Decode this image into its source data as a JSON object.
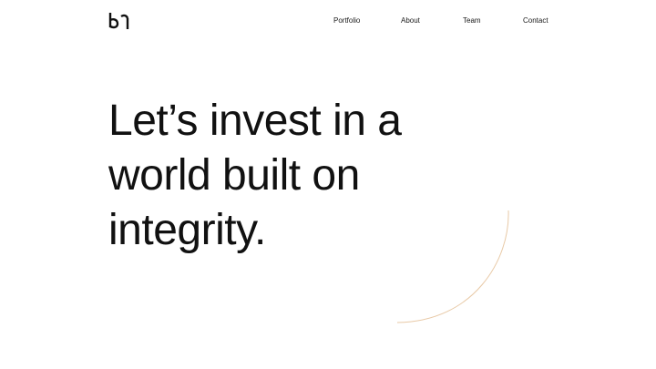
{
  "nav": {
    "items": [
      {
        "label": "Portfolio"
      },
      {
        "label": "About"
      },
      {
        "label": "Team"
      },
      {
        "label": "Contact"
      }
    ]
  },
  "hero": {
    "line1": "Let’s invest in a",
    "line2": "world built on",
    "line3": "integrity."
  },
  "colors": {
    "text": "#111111",
    "background": "#ffffff",
    "accent_arc": "#e8c9a6"
  },
  "icons": {
    "logo": "brand-monogram-logo"
  }
}
